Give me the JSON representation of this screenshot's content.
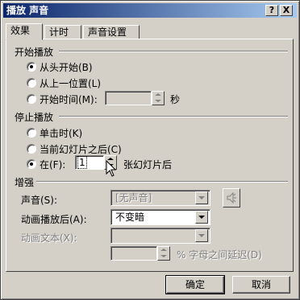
{
  "window": {
    "title": "播放 声音",
    "help_label": "?",
    "close_label": "X"
  },
  "tabs": [
    {
      "label": "效果"
    },
    {
      "label": "计时"
    },
    {
      "label": "声音设置"
    }
  ],
  "start": {
    "group_label": "开始播放",
    "from_beginning": "从头开始(B)",
    "from_last_position": "从上一位置(L)",
    "start_time": "开始时间(M):",
    "start_time_value": "",
    "seconds_unit": "秒"
  },
  "stop": {
    "group_label": "停止播放",
    "on_click": "单击时(K)",
    "after_current_slide": "当前幻灯片之后(C)",
    "after_label": "在(F):",
    "after_value": "1",
    "after_unit": "张幻灯片后"
  },
  "enhance": {
    "group_label": "增强",
    "sound_label": "声音(S):",
    "sound_value": "[无声音]",
    "after_anim_label": "动画播放后(A):",
    "after_anim_value": "不变暗",
    "anim_text_label": "动画文本(X):",
    "anim_text_value": "",
    "delay_value": "",
    "delay_label": "% 字母之间延迟(D)"
  },
  "buttons": {
    "ok": "确定",
    "cancel": "取消"
  },
  "icons": [
    "help-icon",
    "close-icon",
    "speaker-icon",
    "cursor-icon"
  ]
}
